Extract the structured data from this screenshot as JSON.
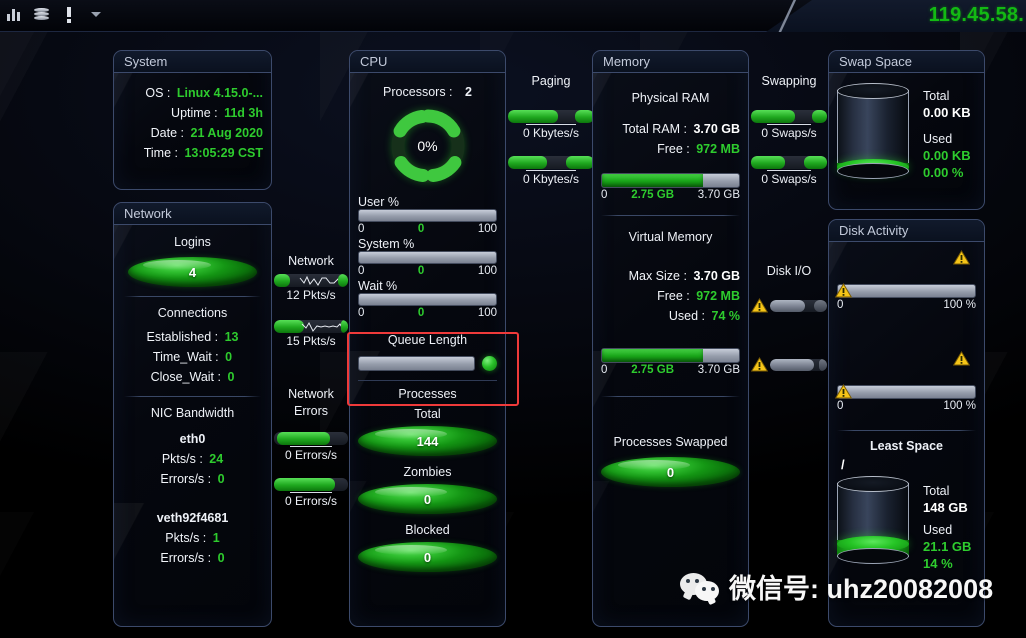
{
  "topbar": {
    "icons": [
      "bar-chart-icon",
      "database-icon",
      "alert-icon",
      "dropdown-caret-icon"
    ],
    "ip_address": "119.45.58."
  },
  "system": {
    "title": "System",
    "rows": [
      {
        "label": "OS :",
        "value": "Linux  4.15.0-..."
      },
      {
        "label": "Uptime :",
        "value": "11d 3h"
      },
      {
        "label": "Date :",
        "value": "21 Aug 2020"
      },
      {
        "label": "Time :",
        "value": "13:05:29 CST"
      }
    ]
  },
  "network": {
    "title": "Network",
    "logins_label": "Logins",
    "logins_value": "4",
    "connections_label": "Connections",
    "connections": [
      {
        "label": "Established :",
        "value": "13"
      },
      {
        "label": "Time_Wait :",
        "value": "0"
      },
      {
        "label": "Close_Wait :",
        "value": "0"
      }
    ],
    "nic_label": "NIC Bandwidth",
    "nics": [
      {
        "name": "eth0",
        "pkts_label": "Pkts/s :",
        "pkts": "24",
        "errors_label": "Errors/s :",
        "errors": "0"
      },
      {
        "name": "veth92f4681",
        "pkts_label": "Pkts/s :",
        "pkts": "1",
        "errors_label": "Errors/s :",
        "errors": "0"
      }
    ]
  },
  "network_col": {
    "title": "Network",
    "bars": [
      {
        "caption": "12 Pkts/s",
        "green_pct": 22,
        "has_trace": true
      },
      {
        "caption": "15 Pkts/s",
        "green_pct": 40,
        "has_trace": true
      }
    ],
    "errors_title_line1": "Network",
    "errors_title_line2": "Errors",
    "error_bars": [
      {
        "caption": "0 Errors/s",
        "green_pct": 72
      },
      {
        "caption": "0 Errors/s",
        "green_pct": 82
      }
    ]
  },
  "cpu": {
    "title": "CPU",
    "processors_label": "Processors :",
    "processors_value": "2",
    "gauge_percent": "0%",
    "gauge_value": 0,
    "meters": [
      {
        "label": "User %",
        "value": 0,
        "start": "0",
        "mid": "0",
        "end": "100"
      },
      {
        "label": "System %",
        "value": 0,
        "start": "0",
        "mid": "0",
        "end": "100"
      },
      {
        "label": "Wait %",
        "value": 0,
        "start": "0",
        "mid": "0",
        "end": "100"
      }
    ],
    "queue_label": "Queue Length",
    "queue_value": 0,
    "processes_label": "Processes",
    "processes": [
      {
        "label": "Total",
        "value": "144"
      },
      {
        "label": "Zombies",
        "value": "0"
      },
      {
        "label": "Blocked",
        "value": "0"
      }
    ]
  },
  "paging": {
    "title": "Paging",
    "bars": [
      {
        "caption": "0 Kbytes/s",
        "green_pct": 58
      },
      {
        "caption": "0 Kbytes/s",
        "green_pct": 45
      }
    ]
  },
  "memory": {
    "title": "Memory",
    "physical_label": "Physical RAM",
    "physical_rows": [
      {
        "label": "Total RAM :",
        "value": "3.70 GB",
        "color": "white"
      },
      {
        "label": "Free :",
        "value": "972 MB",
        "color": "green"
      }
    ],
    "physical_meter": {
      "fill_pct": 74,
      "start": "0",
      "mid": "2.75 GB",
      "end": "3.70 GB"
    },
    "virtual_label": "Virtual Memory",
    "virtual_rows": [
      {
        "label": "Max Size :",
        "value": "3.70 GB",
        "color": "white"
      },
      {
        "label": "Free :",
        "value": "972 MB",
        "color": "green"
      },
      {
        "label": "Used :",
        "value": "74 %",
        "color": "green"
      }
    ],
    "virtual_meter": {
      "fill_pct": 74,
      "start": "0",
      "mid": "2.75 GB",
      "end": "3.70 GB"
    },
    "swapped_label": "Processes Swapped",
    "swapped_value": "0"
  },
  "swapping_col": {
    "title": "Swapping",
    "bars": [
      {
        "caption": "0 Swaps/s",
        "green_pct": 58
      },
      {
        "caption": "0 Swaps/s",
        "green_pct": 45
      }
    ]
  },
  "diskio_col": {
    "title": "Disk I/O",
    "bars": [
      {
        "gray_pct": 60,
        "warn": true
      },
      {
        "gray_pct": 78,
        "warn": true
      }
    ]
  },
  "swap_space": {
    "title": "Swap Space",
    "total_label": "Total",
    "total_value": "0.00 KB",
    "used_label": "Used",
    "used_value": "0.00 KB",
    "used_pct": "0.00 %",
    "fill_pct": 4
  },
  "disk_activity": {
    "title": "Disk Activity",
    "bars": [
      {
        "start": "0",
        "end": "100 %",
        "warn_left": true,
        "warn_top": true
      },
      {
        "start": "0",
        "end": "100 %",
        "warn_left": true,
        "warn_top": true
      }
    ],
    "least_space_label": "Least Space",
    "mount": "/",
    "total_label": "Total",
    "total_value": "148 GB",
    "used_label": "Used",
    "used_value": "21.1 GB",
    "used_pct": "14 %",
    "fill_pct": 14
  },
  "watermark": {
    "text": "微信号: uhz20082008"
  }
}
